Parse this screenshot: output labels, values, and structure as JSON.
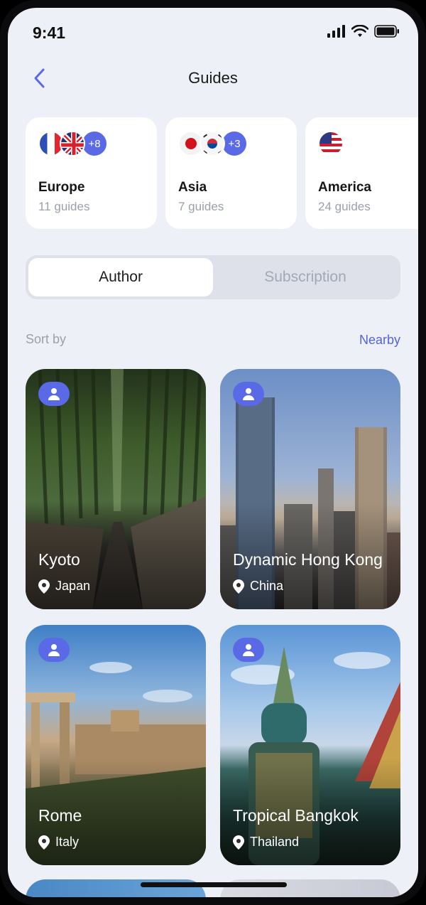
{
  "status": {
    "time": "9:41"
  },
  "nav": {
    "title": "Guides"
  },
  "regions": [
    {
      "name": "Europe",
      "count": "11 guides",
      "more": "+8"
    },
    {
      "name": "Asia",
      "count": "7 guides",
      "more": "+3"
    },
    {
      "name": "America",
      "count": "24 guides",
      "more": ""
    }
  ],
  "tabs": {
    "active": "Author",
    "inactive": "Subscription"
  },
  "sort": {
    "label": "Sort by",
    "value": "Nearby"
  },
  "guides": [
    {
      "title": "Kyoto",
      "location": "Japan"
    },
    {
      "title": "Dynamic Hong Kong",
      "location": "China"
    },
    {
      "title": "Rome",
      "location": "Italy"
    },
    {
      "title": "Tropical Bangkok",
      "location": "Thailand"
    }
  ],
  "colors": {
    "accent": "#5a6ae6",
    "link": "#5563d9",
    "background": "#eef0f7"
  }
}
